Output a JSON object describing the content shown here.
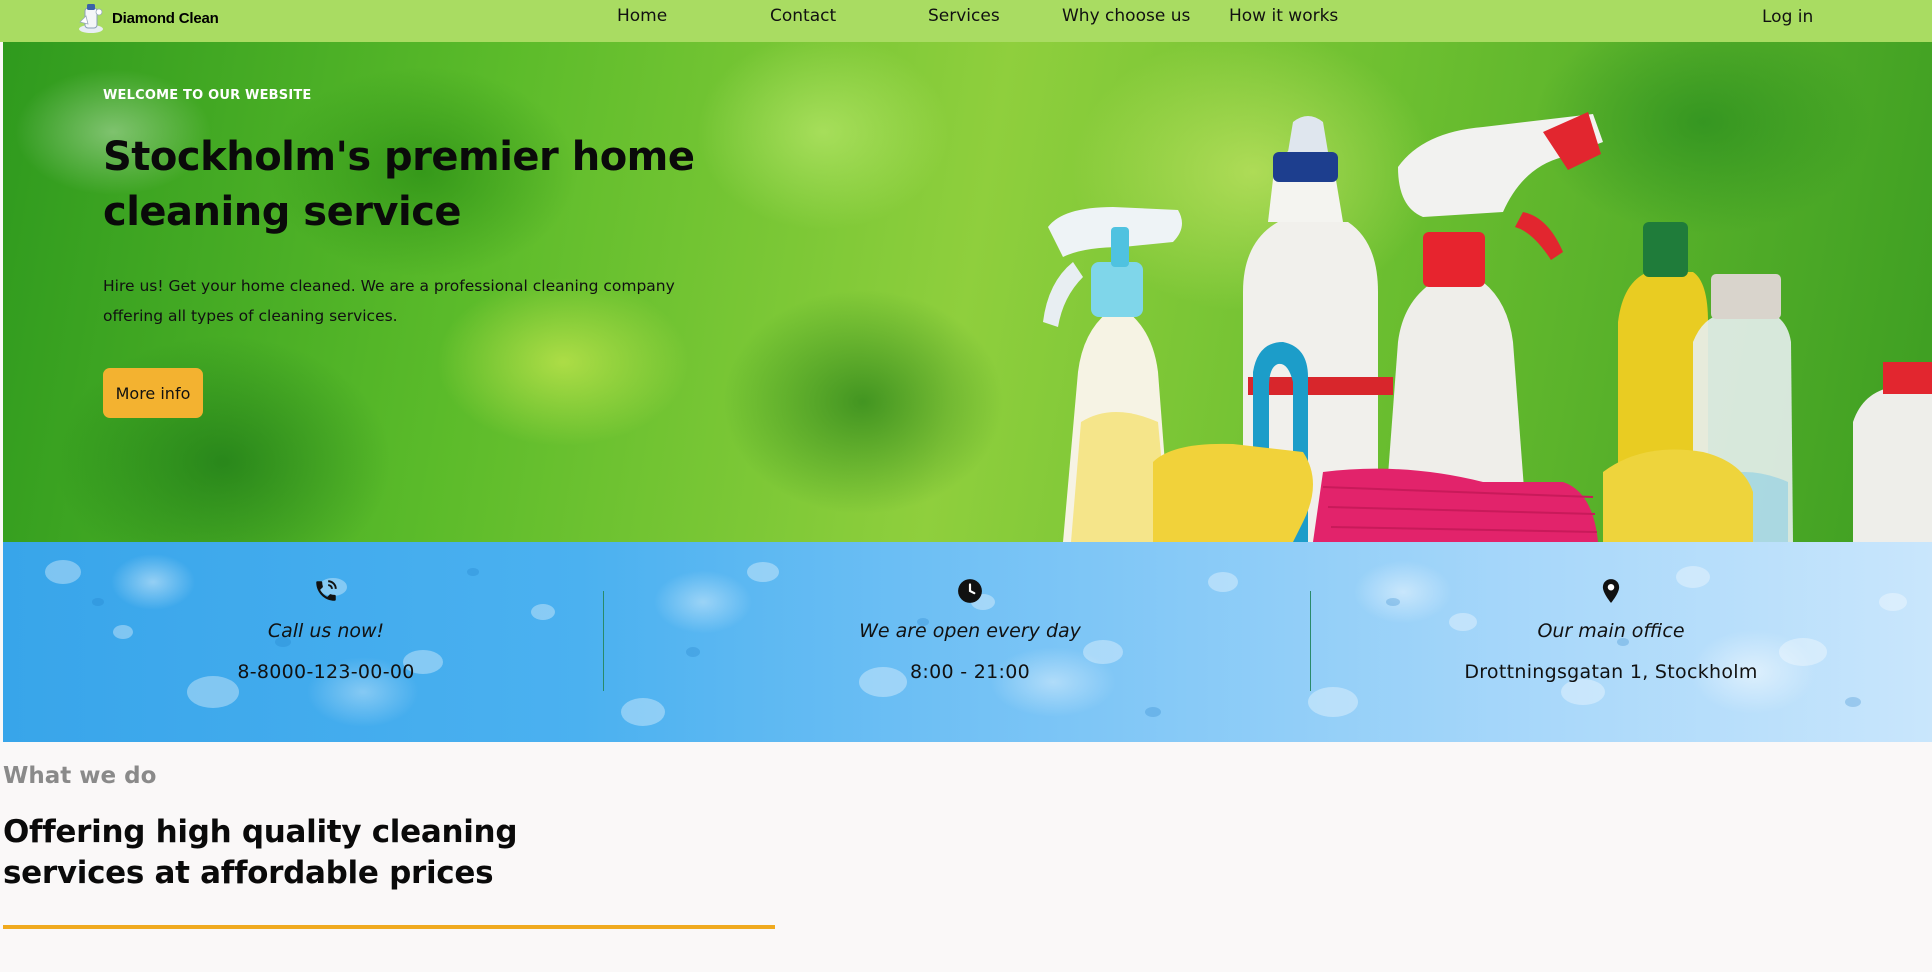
{
  "brand": {
    "name": "Diamond Clean",
    "logo_icon": "diamond-logo-icon"
  },
  "nav": {
    "items": [
      {
        "label": "Home"
      },
      {
        "label": "Contact"
      },
      {
        "label": "Services"
      },
      {
        "label": "Why choose us"
      },
      {
        "label": "How it works"
      }
    ],
    "login_label": "Log in"
  },
  "hero": {
    "eyebrow": "WELCOME TO OUR WEBSITE",
    "title": "Stockholm's premier home cleaning service",
    "description": "Hire us! Get your home cleaned. We are a professional cleaning company offering all types of cleaning services.",
    "button_label": "More info"
  },
  "info": {
    "phone": {
      "icon": "phone-icon",
      "title": "Call us now!",
      "value": "8-8000-123-00-00"
    },
    "hours": {
      "icon": "clock-icon",
      "title": "We are open every day",
      "value": "8:00 - 21:00"
    },
    "office": {
      "icon": "map-pin-icon",
      "title": "Our main office",
      "value": "Drottningsgatan 1, Stockholm"
    }
  },
  "what_we_do": {
    "eyebrow": "What we do",
    "heading": "Offering high quality cleaning services at affordable prices"
  },
  "colors": {
    "nav_bg": "#a9dc62",
    "accent": "#f3b230",
    "rule": "#f0aa1f",
    "page_bg": "#faf8f8"
  }
}
